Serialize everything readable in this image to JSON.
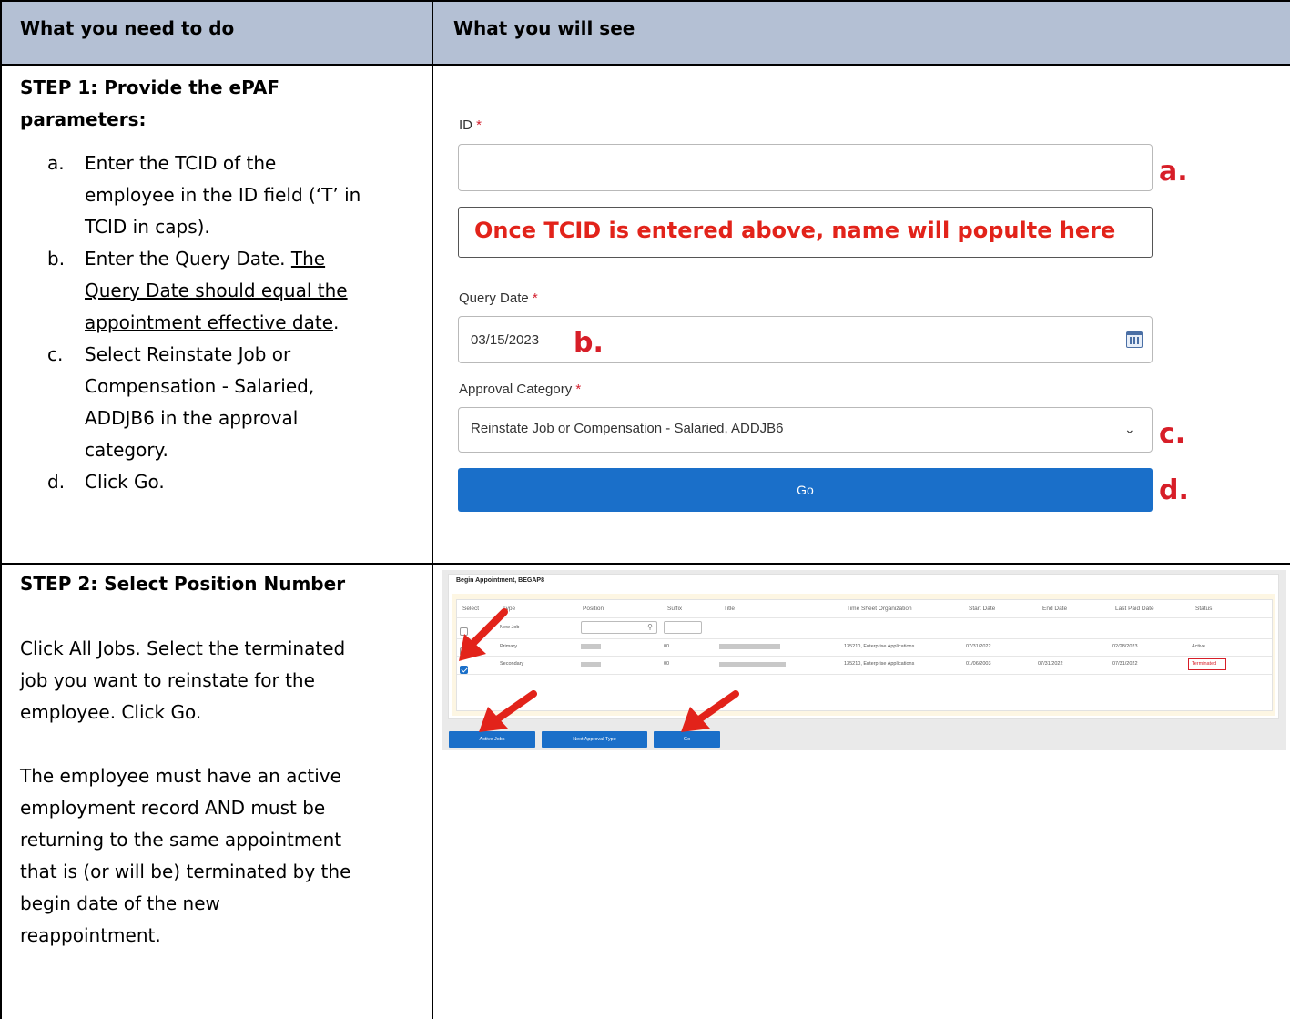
{
  "header": {
    "left": "What you need to do",
    "right": "What you will see"
  },
  "step1": {
    "title_line1": "STEP 1: Provide the ePAF",
    "title_line2": "parameters:",
    "items": [
      {
        "marker": "a.",
        "lines": [
          "Enter the TCID of the",
          "employee in the ID field (‘T’ in",
          "TCID in caps)."
        ]
      },
      {
        "marker": "b.",
        "line1": "Enter the Query Date.",
        "u1": "The",
        "u2": "Query Date should equal the",
        "u3": "appointment effective date",
        "tail": "."
      },
      {
        "marker": "c.",
        "lines": [
          "Select Reinstate Job or",
          "Compensation - Salaried,",
          "ADDJB6 in the approval",
          "category."
        ]
      },
      {
        "marker": "d.",
        "lines": [
          "Click Go."
        ]
      }
    ],
    "form": {
      "id_label": "ID",
      "required_mark": "*",
      "id_value": "",
      "name_note": "Once TCID is entered above, name will populte here",
      "query_date_label": "Query Date",
      "query_date_value": "03/15/2023",
      "approval_label": "Approval Category",
      "approval_value": "Reinstate Job or Compensation - Salaried, ADDJB6",
      "go_label": "Go",
      "marks": {
        "a": "a.",
        "b": "b.",
        "c": "c.",
        "d": "d."
      }
    }
  },
  "step2": {
    "title": "STEP 2: Select Position Number",
    "para1_lines": [
      "Click All Jobs. Select the terminated",
      "job you want to reinstate for the",
      "employee.  Click Go."
    ],
    "para2_lines": [
      "The employee must have an active",
      "employment record AND must be",
      "returning to the same appointment",
      "that is (or will be) terminated by the",
      "begin date of the new",
      "reappointment."
    ],
    "screenshot": {
      "title": "Begin Appointment, BEGAP8",
      "columns": [
        "Select",
        "Type",
        "Position",
        "Suffix",
        "Title",
        "Time Sheet Organization",
        "Start Date",
        "End Date",
        "Last Paid Date",
        "Status"
      ],
      "rows": [
        {
          "type": "New Job",
          "suffix": "",
          "org": "",
          "start": "",
          "end": "",
          "last_paid": "",
          "status": "",
          "checked": false
        },
        {
          "type": "Primary",
          "suffix": "00",
          "org": "135210, Enterprise Applications",
          "start": "07/31/2022",
          "end": "",
          "last_paid": "02/28/2023",
          "status": "Active",
          "checked": false
        },
        {
          "type": "Secondary",
          "suffix": "00",
          "org": "135210, Enterprise Applications",
          "start": "01/06/2003",
          "end": "07/31/2022",
          "last_paid": "07/31/2022",
          "status": "Terminated",
          "checked": true
        }
      ],
      "buttons": [
        "Active Jobs",
        "Next Approval Type",
        "Go"
      ]
    }
  },
  "colors": {
    "header_bg": "#b4c0d4",
    "primary_button": "#1a6fc9",
    "annotation_red": "#d71e28"
  }
}
